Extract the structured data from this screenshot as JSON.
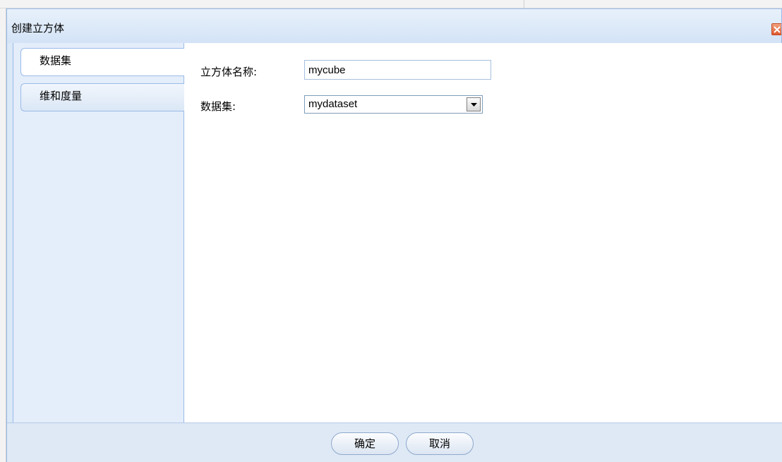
{
  "dialog": {
    "title": "创建立方体",
    "close_icon": "close-icon"
  },
  "tabs": [
    {
      "label": "数据集",
      "active": true
    },
    {
      "label": "维和度量",
      "active": false
    }
  ],
  "form": {
    "cube_name_label": "立方体名称:",
    "cube_name_value": "mycube",
    "dataset_label": "数据集:",
    "dataset_value": "mydataset",
    "dropdown_icon": "chevron-down-icon"
  },
  "footer": {
    "ok_label": "确定",
    "cancel_label": "取消"
  },
  "colors": {
    "panel": "#dbe8f7",
    "border": "#99bbe8",
    "close": "#e0582f"
  }
}
